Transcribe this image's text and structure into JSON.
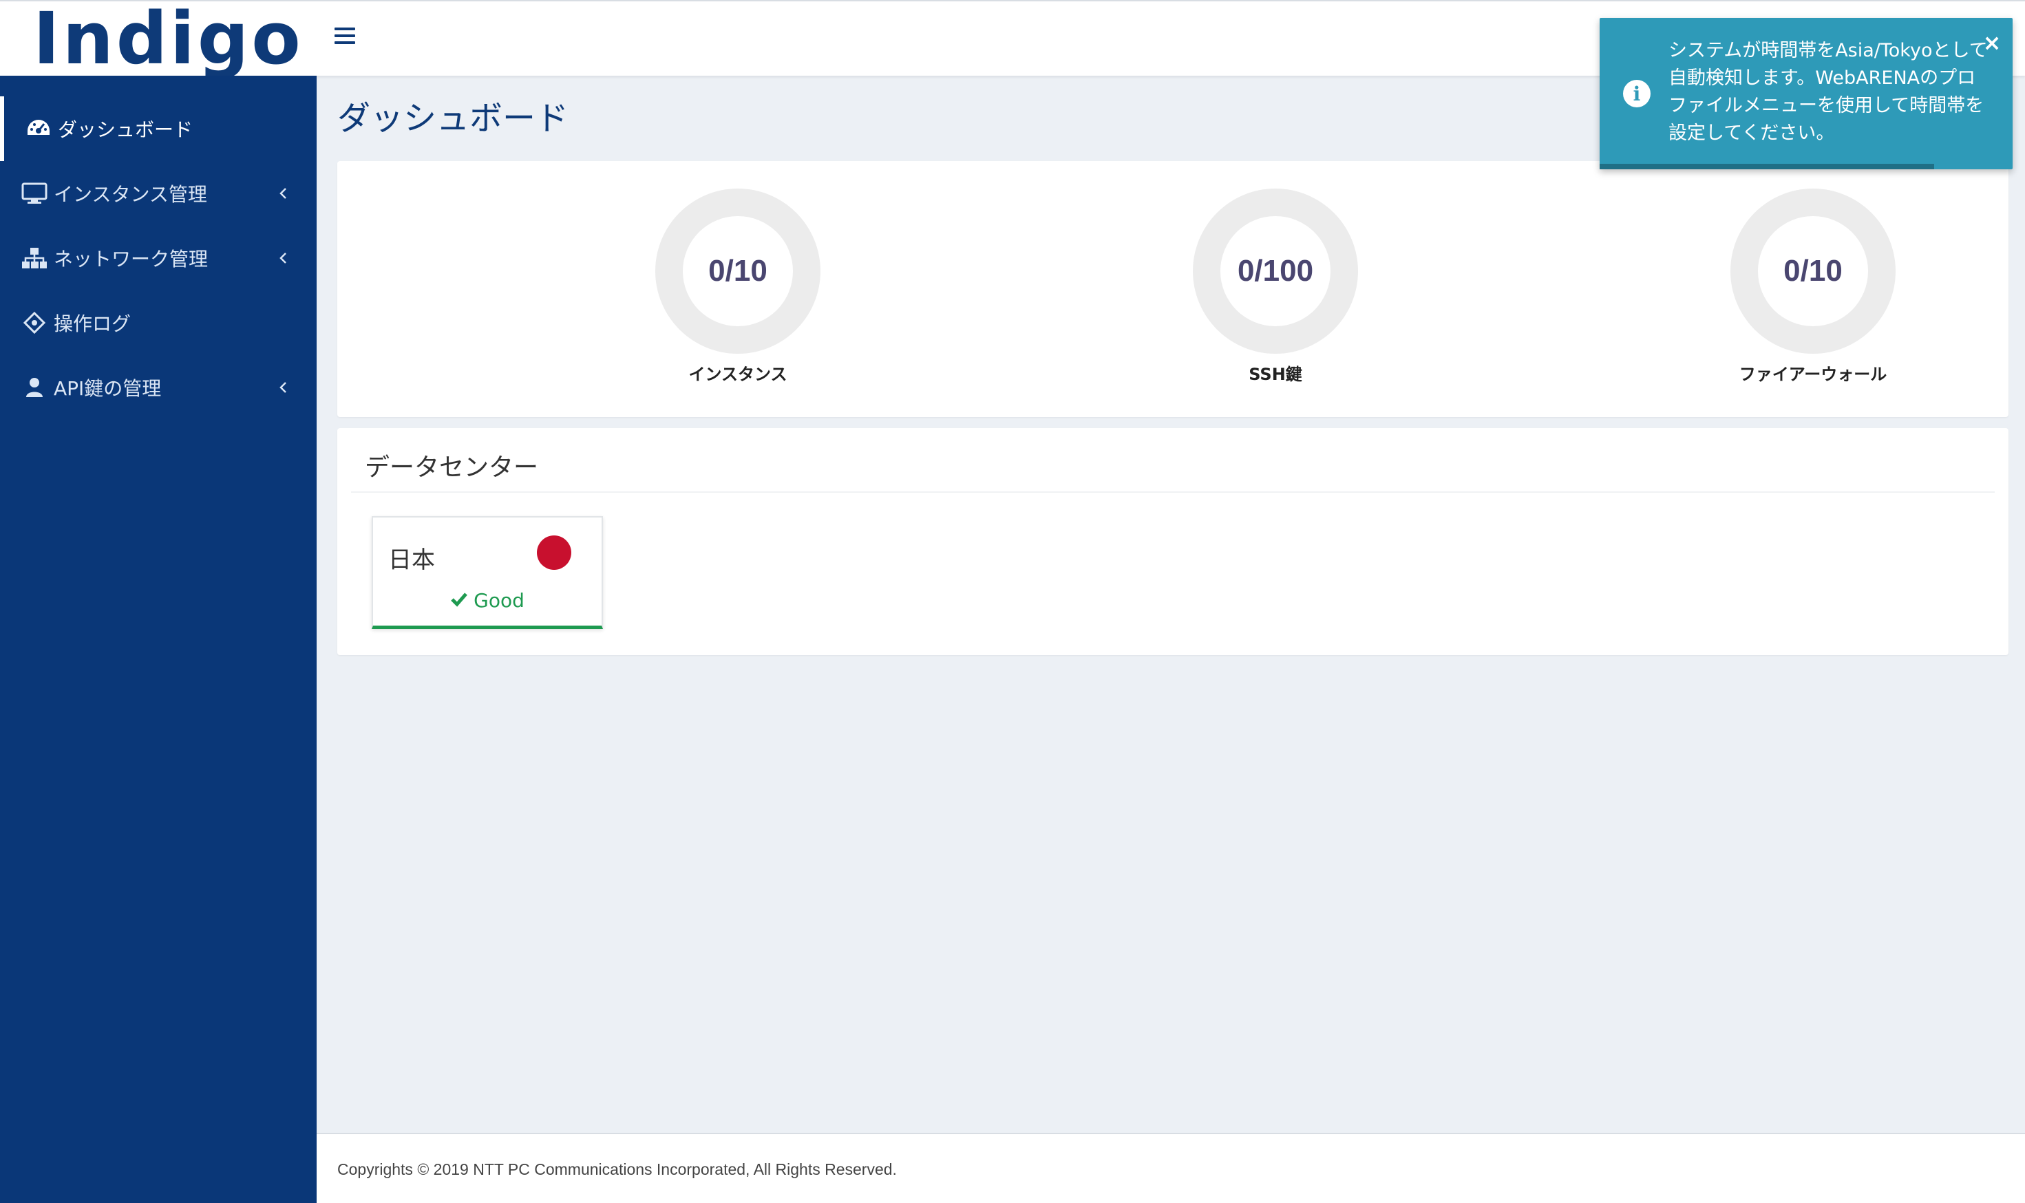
{
  "header": {
    "logo_text": "Indigo",
    "menu_icon": "hamburger-menu-icon"
  },
  "sidebar": {
    "items": [
      {
        "label": "ダッシュボード",
        "icon": "dashboard-gauge-icon",
        "active": true,
        "has_submenu": false
      },
      {
        "label": "インスタンス管理",
        "icon": "monitor-icon",
        "active": false,
        "has_submenu": true
      },
      {
        "label": "ネットワーク管理",
        "icon": "sitemap-icon",
        "active": false,
        "has_submenu": true
      },
      {
        "label": "操作ログ",
        "icon": "crosshair-icon",
        "active": false,
        "has_submenu": false
      },
      {
        "label": "API鍵の管理",
        "icon": "user-icon",
        "active": false,
        "has_submenu": true
      }
    ]
  },
  "main": {
    "title": "ダッシュボード",
    "stats": [
      {
        "value": "0/10",
        "label": "インスタンス"
      },
      {
        "value": "0/100",
        "label": "SSH鍵"
      },
      {
        "value": "0/10",
        "label": "ファイアーウォール"
      }
    ],
    "datacenter": {
      "title": "データセンター",
      "card": {
        "country": "日本",
        "status": "Good",
        "flag": "japan-flag",
        "status_color": "#1e9a50"
      }
    }
  },
  "footer": {
    "text": "Copyrights © 2019 NTT PC Communications Incorporated, All Rights Reserved."
  },
  "toast": {
    "message": "システムが時間帯をAsia/Tokyoとして自動検知します。WebARENAのプロファイルメニューを使用して時間帯を設定してください。",
    "icon": "info-icon",
    "close_symbol": "×",
    "progress": 0.81
  },
  "colors": {
    "sidebar": "#0a3778",
    "brand": "#0e3a78",
    "toast": "#2e9ab8",
    "good": "#1e9a50"
  }
}
